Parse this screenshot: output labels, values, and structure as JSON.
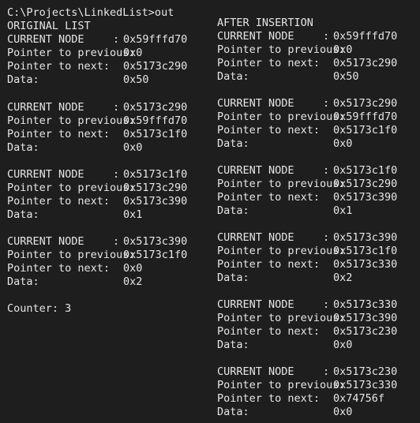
{
  "terminal": {
    "prompt_line": "C:\\Projects\\LinkedList>out",
    "original_header": "ORIGINAL LIST",
    "after_header": "AFTER INSERTION",
    "labels": {
      "current_node": "CURRENT NODE",
      "previous": "Pointer to previous:",
      "next": "Pointer to next:",
      "data": "Data:"
    },
    "original_nodes": [
      {
        "current": "0x59fffd70",
        "previous": "0x0",
        "next": "0x5173c290",
        "data": "0x50"
      },
      {
        "current": "0x5173c290",
        "previous": "0x59fffd70",
        "next": "0x5173c1f0",
        "data": "0x0"
      },
      {
        "current": "0x5173c1f0",
        "previous": "0x5173c290",
        "next": "0x5173c390",
        "data": "0x1"
      },
      {
        "current": "0x5173c390",
        "previous": "0x5173c1f0",
        "next": "0x0",
        "data": "0x2"
      }
    ],
    "counter_line": "Counter: 3",
    "after_nodes": [
      {
        "current": "0x59fffd70",
        "previous": "0x0",
        "next": "0x5173c290",
        "data": "0x50"
      },
      {
        "current": "0x5173c290",
        "previous": "0x59fffd70",
        "next": "0x5173c1f0",
        "data": "0x0"
      },
      {
        "current": "0x5173c1f0",
        "previous": "0x5173c290",
        "next": "0x5173c390",
        "data": "0x1"
      },
      {
        "current": "0x5173c390",
        "previous": "0x5173c1f0",
        "next": "0x5173c330",
        "data": "0x2"
      },
      {
        "current": "0x5173c330",
        "previous": "0x5173c390",
        "next": "0x5173c230",
        "data": "0x0"
      },
      {
        "current": "0x5173c230",
        "previous": "0x5173c330",
        "next": "0x74756f",
        "data": "0x0"
      }
    ]
  }
}
